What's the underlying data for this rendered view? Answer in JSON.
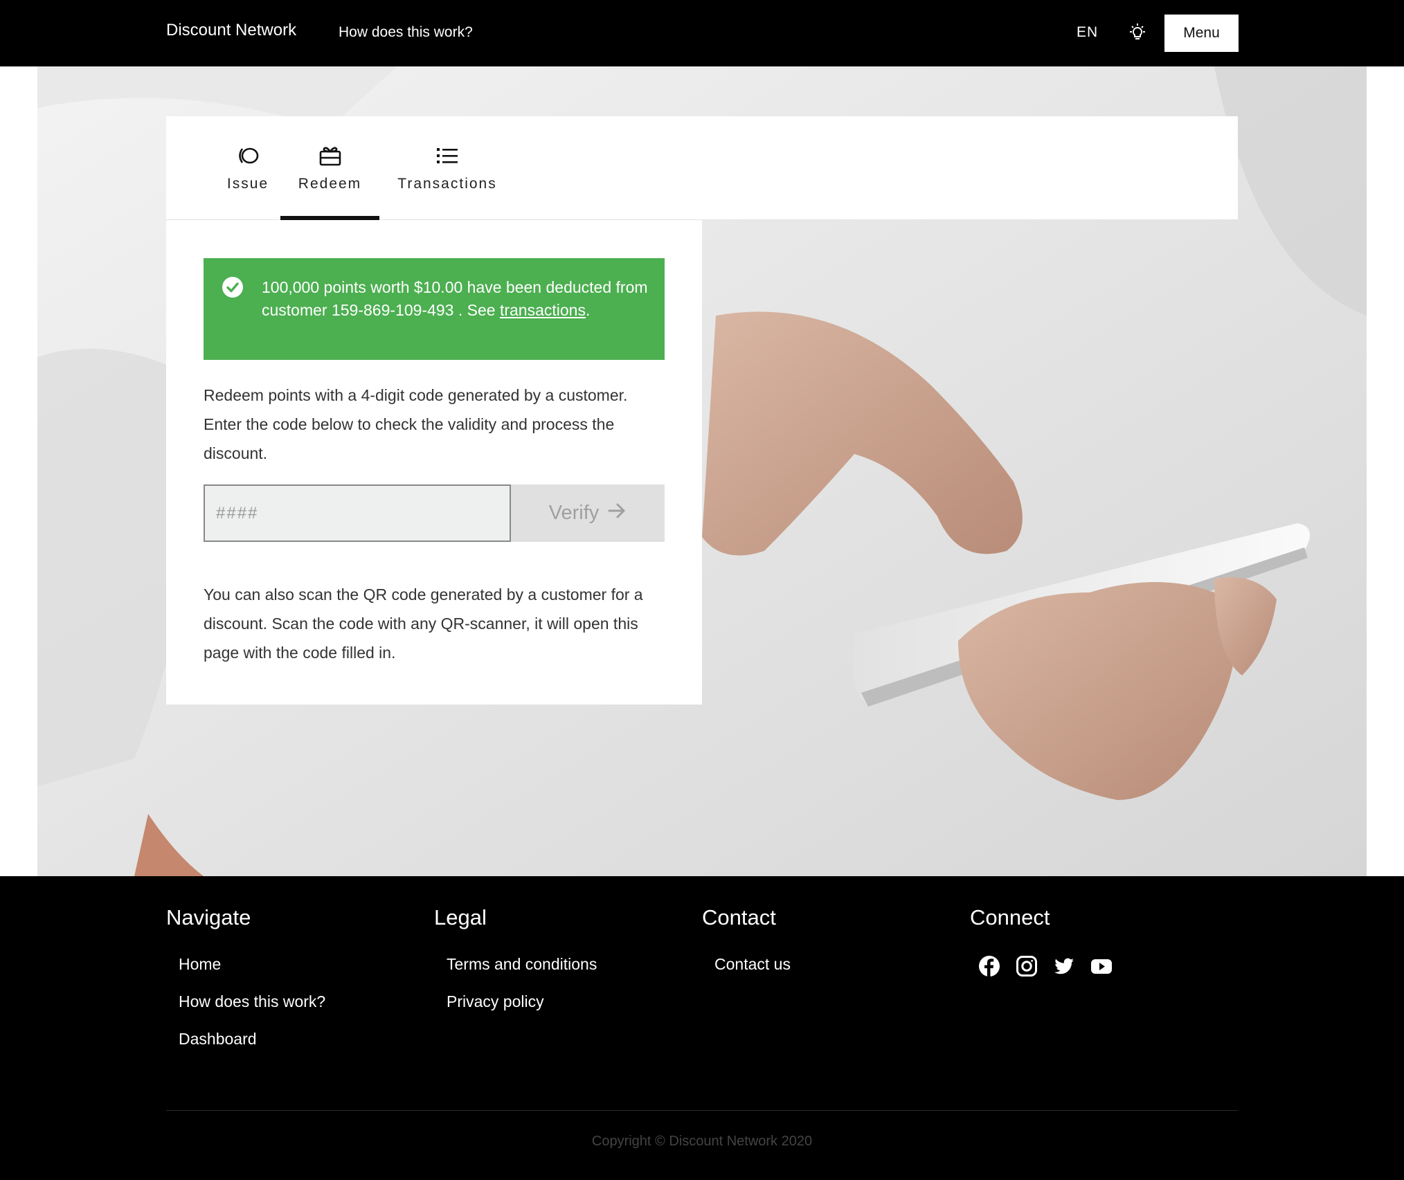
{
  "nav": {
    "brand": "Discount Network",
    "how_link": "How does this work?",
    "language": "EN",
    "theme_icon": "lightbulb-icon",
    "menu_label": "Menu"
  },
  "tabs": [
    {
      "label": "Issue",
      "icon": "coin-icon",
      "active": false
    },
    {
      "label": "Redeem",
      "icon": "gift-card-icon",
      "active": true
    },
    {
      "label": "Transactions",
      "icon": "list-icon",
      "active": false
    }
  ],
  "alert": {
    "icon": "check-circle-icon",
    "message_prefix": "100,000 points worth $10.00 have been deducted from customer 159-869-109-493 . See ",
    "link_text": "transactions",
    "message_suffix": ".",
    "color": "#4caf50"
  },
  "redeem": {
    "description": "Redeem points with a 4-digit code generated by a customer. Enter the code below to check the validity and process the discount.",
    "code_placeholder": "####",
    "code_value": "",
    "verify_label": "Verify",
    "qr_description": "You can also scan the QR code generated by a customer for a discount. Scan the code with any QR-scanner, it will open this page with the code filled in."
  },
  "footer": {
    "navigate": {
      "heading": "Navigate",
      "items": [
        "Home",
        "How does this work?",
        "Dashboard"
      ]
    },
    "legal": {
      "heading": "Legal",
      "items": [
        "Terms and conditions",
        "Privacy policy"
      ]
    },
    "contact": {
      "heading": "Contact",
      "items": [
        "Contact us"
      ]
    },
    "connect": {
      "heading": "Connect",
      "icons": [
        "facebook-icon",
        "instagram-icon",
        "twitter-icon",
        "youtube-icon"
      ]
    },
    "copyright": "Copyright © Discount Network 2020"
  }
}
